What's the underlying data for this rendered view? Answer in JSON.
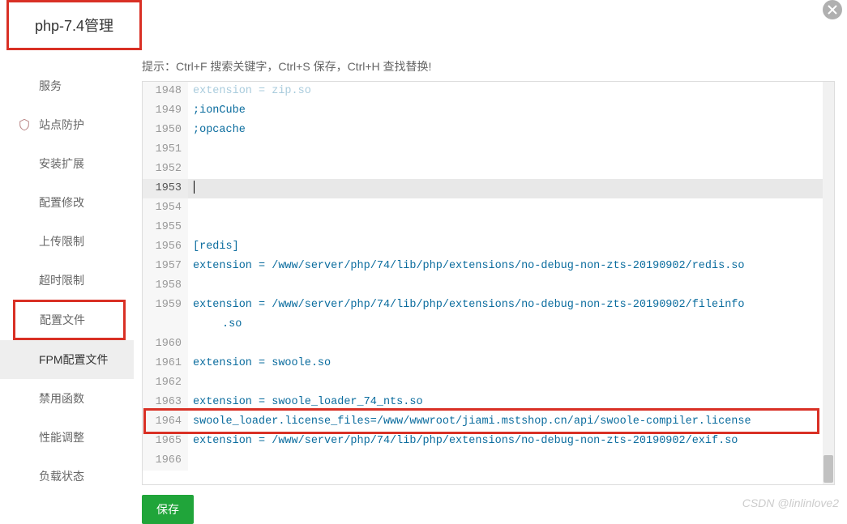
{
  "title": "php-7.4管理",
  "sidebar": {
    "items": [
      {
        "label": "服务",
        "icon": ""
      },
      {
        "label": "站点防护",
        "icon": "shield"
      },
      {
        "label": "安装扩展",
        "icon": ""
      },
      {
        "label": "配置修改",
        "icon": ""
      },
      {
        "label": "上传限制",
        "icon": ""
      },
      {
        "label": "超时限制",
        "icon": ""
      },
      {
        "label": "配置文件",
        "icon": "",
        "boxed": true
      },
      {
        "label": "FPM配置文件",
        "icon": "",
        "active": true
      },
      {
        "label": "禁用函数",
        "icon": ""
      },
      {
        "label": "性能调整",
        "icon": ""
      },
      {
        "label": "负载状态",
        "icon": ""
      }
    ]
  },
  "main": {
    "hint": "提示：Ctrl+F 搜索关键字，Ctrl+S 保存，Ctrl+H 查找替换!",
    "save_label": "保存"
  },
  "editor": {
    "lines": [
      {
        "n": 1948,
        "text": "extension = zip.so",
        "faded": true
      },
      {
        "n": 1949,
        "text": ";ionCube"
      },
      {
        "n": 1950,
        "text": ";opcache"
      },
      {
        "n": 1951,
        "text": ""
      },
      {
        "n": 1952,
        "text": ""
      },
      {
        "n": 1953,
        "text": "",
        "active": true
      },
      {
        "n": 1954,
        "text": ""
      },
      {
        "n": 1955,
        "text": ""
      },
      {
        "n": 1956,
        "text": "[redis]"
      },
      {
        "n": 1957,
        "text": "extension = /www/server/php/74/lib/php/extensions/no-debug-non-zts-20190902/redis.so"
      },
      {
        "n": 1958,
        "text": ""
      },
      {
        "n": 1959,
        "text": "extension = /www/server/php/74/lib/php/extensions/no-debug-non-zts-20190902/fileinfo",
        "wrap": ".so"
      },
      {
        "n": 1960,
        "text": ""
      },
      {
        "n": 1961,
        "text": "extension = swoole.so"
      },
      {
        "n": 1962,
        "text": ""
      },
      {
        "n": 1963,
        "text": "extension = swoole_loader_74_nts.so"
      },
      {
        "n": 1964,
        "text": "swoole_loader.license_files=/www/wwwroot/jiami.mstshop.cn/api/swoole-compiler.license",
        "boxed": true
      },
      {
        "n": 1965,
        "text": "extension = /www/server/php/74/lib/php/extensions/no-debug-non-zts-20190902/exif.so"
      },
      {
        "n": 1966,
        "text": ""
      }
    ]
  },
  "watermark": "CSDN @linlinlove2"
}
